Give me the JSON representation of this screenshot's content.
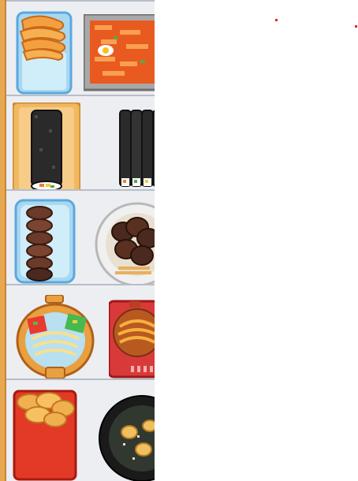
{
  "screen": {
    "background": "#ffffff",
    "panel_background": "#eceef2",
    "accent_trim": "#e8a850"
  },
  "menu": {
    "rows": [
      {
        "items": [
          {
            "icon": "fried-squid-cup-icon"
          },
          {
            "icon": "tteokbokki-tray-icon"
          }
        ]
      },
      {
        "items": [
          {
            "icon": "kimbap-roll-icon"
          },
          {
            "icon": "sliced-kimbap-icon"
          }
        ]
      },
      {
        "items": [
          {
            "icon": "sundae-sausage-cup-icon"
          },
          {
            "icon": "sundae-plate-icon"
          }
        ]
      },
      {
        "items": [
          {
            "icon": "jjolmyeon-pot-icon"
          },
          {
            "icon": "ramyeon-pot-icon"
          }
        ]
      },
      {
        "items": [
          {
            "icon": "fried-dumpling-box-icon"
          },
          {
            "icon": "dumpling-pan-icon"
          }
        ]
      }
    ]
  }
}
